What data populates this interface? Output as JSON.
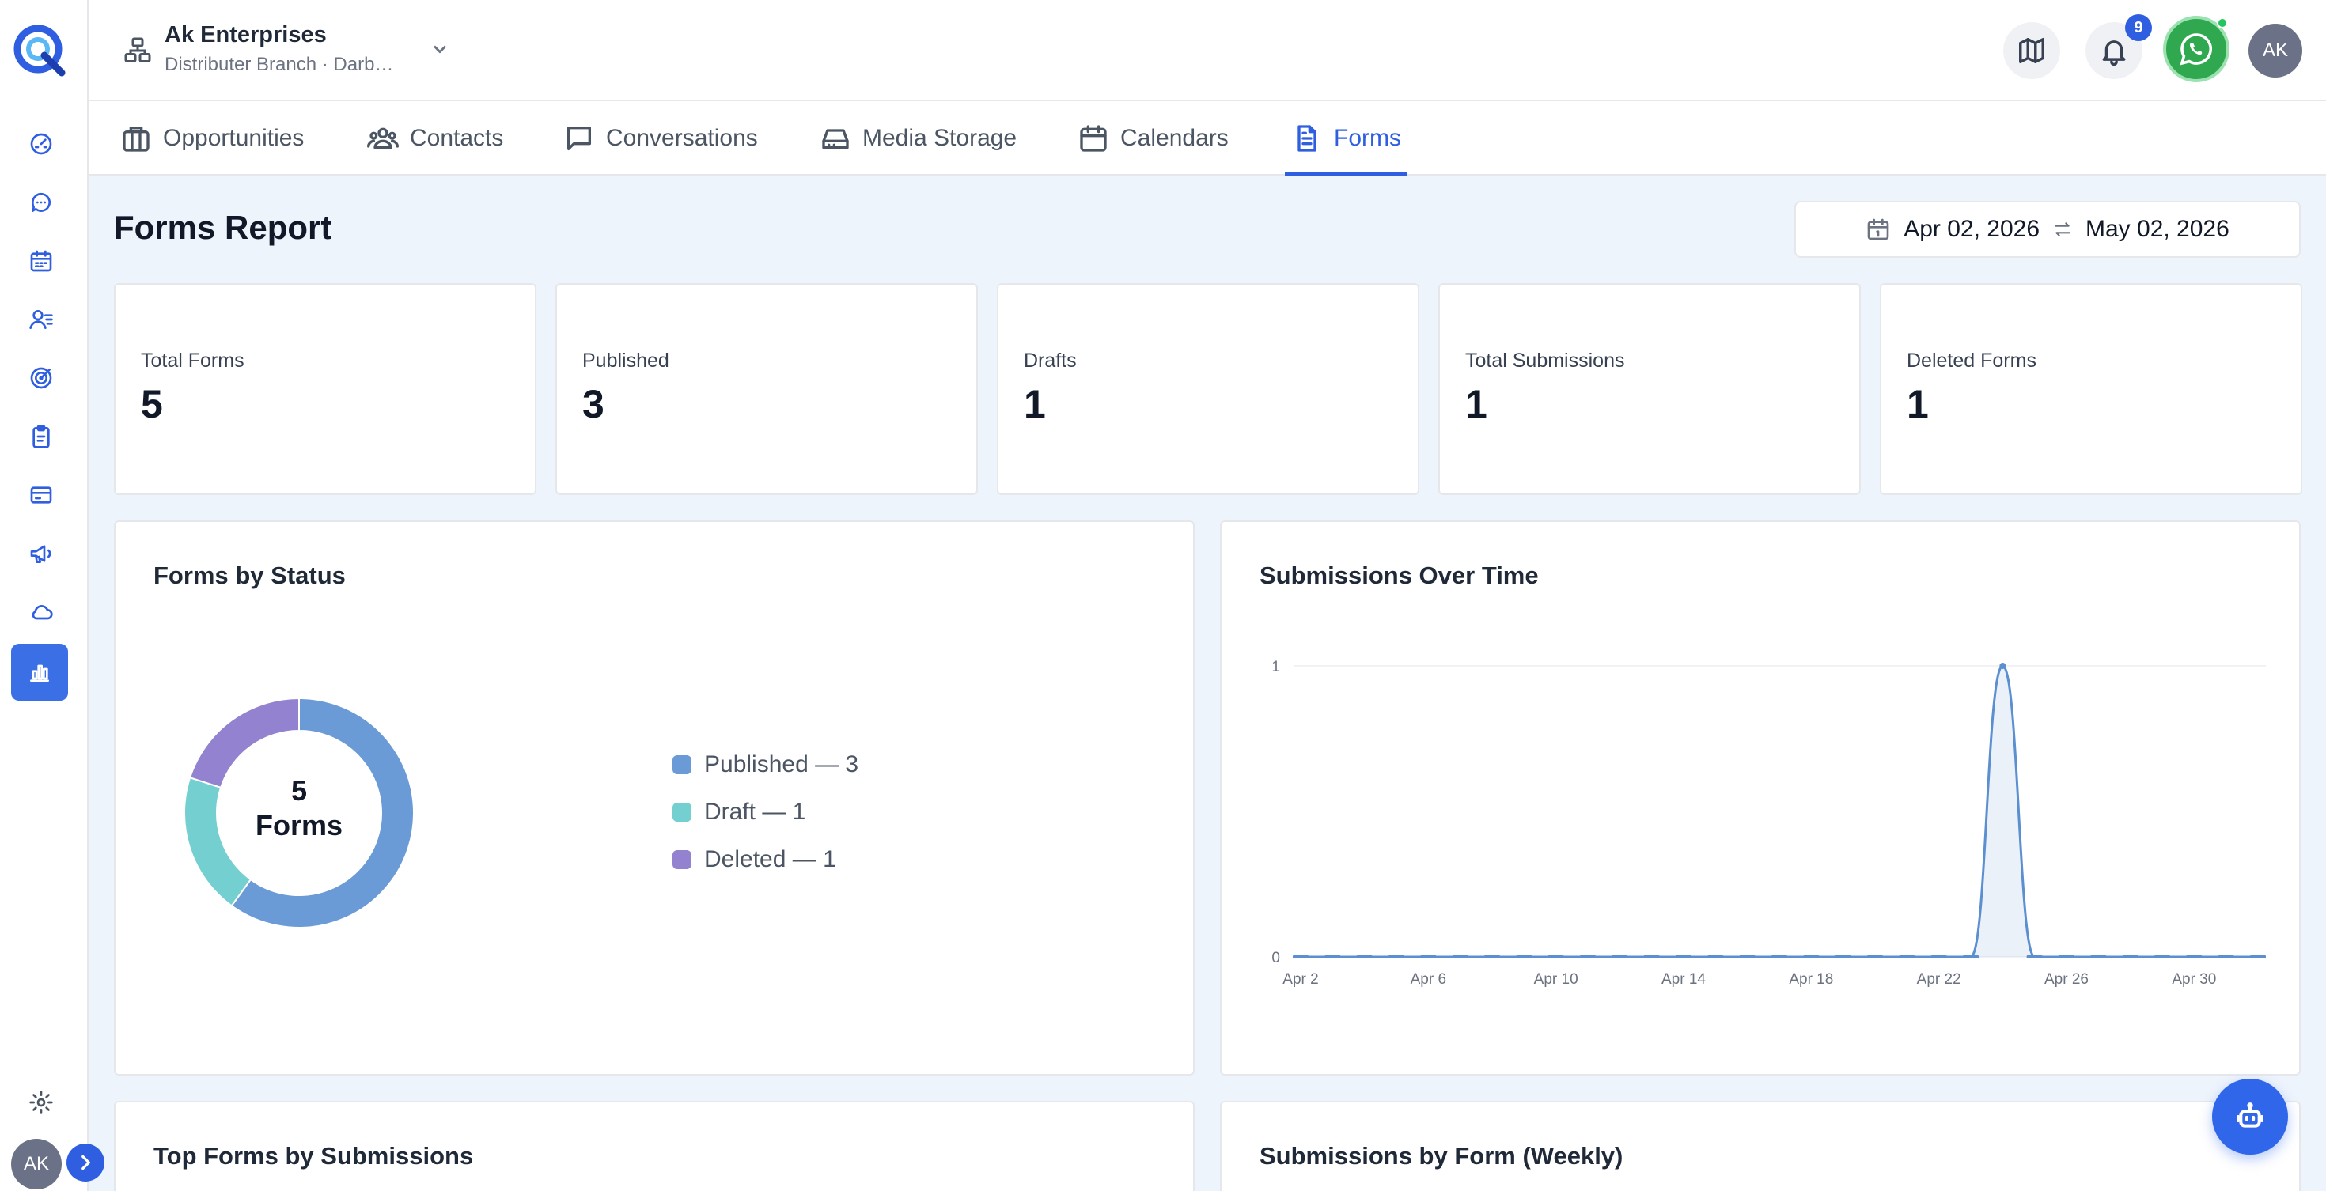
{
  "sidebar": {
    "logo": "app-logo",
    "items": [
      {
        "name": "dashboard-icon"
      },
      {
        "name": "chat-icon"
      },
      {
        "name": "calendar-icon"
      },
      {
        "name": "contacts-icon"
      },
      {
        "name": "target-icon"
      },
      {
        "name": "clipboard-icon"
      },
      {
        "name": "payments-icon"
      },
      {
        "name": "megaphone-icon"
      },
      {
        "name": "cloud-icon"
      },
      {
        "name": "reports-icon",
        "active": true
      }
    ],
    "settings_icon": "gear-icon",
    "avatar_initials": "AK",
    "expand_icon": "chevron-right-icon"
  },
  "header": {
    "business_name": "Ak Enterprises",
    "branch_subtitle": "Distributer Branch · Darb…",
    "notification_count": "9",
    "avatar_initials": "AK",
    "icons": [
      "map-icon",
      "bell-icon",
      "whatsapp-icon"
    ]
  },
  "tabs": [
    {
      "label": "Opportunities",
      "icon": "briefcase-icon"
    },
    {
      "label": "Contacts",
      "icon": "users-icon"
    },
    {
      "label": "Conversations",
      "icon": "message-icon"
    },
    {
      "label": "Media Storage",
      "icon": "drive-icon"
    },
    {
      "label": "Calendars",
      "icon": "calendar-icon"
    },
    {
      "label": "Forms",
      "icon": "document-icon",
      "active": true
    }
  ],
  "page": {
    "title": "Forms Report",
    "date_from": "Apr 02, 2026",
    "date_to": "May 02, 2026"
  },
  "stats": [
    {
      "label": "Total Forms",
      "value": "5"
    },
    {
      "label": "Published",
      "value": "3"
    },
    {
      "label": "Drafts",
      "value": "1"
    },
    {
      "label": "Total Submissions",
      "value": "1"
    },
    {
      "label": "Deleted Forms",
      "value": "1"
    }
  ],
  "panels": {
    "status_title": "Forms by Status",
    "time_title": "Submissions Over Time",
    "top_forms_title": "Top Forms by Submissions",
    "weekly_title": "Submissions by Form (Weekly)"
  },
  "colors": {
    "accent": "#2f5fe0",
    "published": "#6a9bd6",
    "draft": "#74cfd0",
    "deleted": "#9382cf",
    "line": "#5b8fd0"
  },
  "chart_data": [
    {
      "type": "pie",
      "title": "Forms by Status",
      "center_value": "5",
      "center_label": "Forms",
      "legend_position": "right",
      "slices": [
        {
          "label": "Published — 3",
          "value": 3,
          "color": "#6a9bd6"
        },
        {
          "label": "Draft — 1",
          "value": 1,
          "color": "#74cfd0"
        },
        {
          "label": "Deleted — 1",
          "value": 1,
          "color": "#9382cf"
        }
      ]
    },
    {
      "type": "line",
      "title": "Submissions Over Time",
      "xlabel": "",
      "ylabel": "",
      "x": [
        "Apr 2",
        "Apr 3",
        "Apr 4",
        "Apr 5",
        "Apr 6",
        "Apr 7",
        "Apr 8",
        "Apr 9",
        "Apr 10",
        "Apr 11",
        "Apr 12",
        "Apr 13",
        "Apr 14",
        "Apr 15",
        "Apr 16",
        "Apr 17",
        "Apr 18",
        "Apr 19",
        "Apr 20",
        "Apr 21",
        "Apr 22",
        "Apr 23",
        "Apr 24",
        "Apr 25",
        "Apr 26",
        "Apr 27",
        "Apr 28",
        "Apr 29",
        "Apr 30",
        "May 1",
        "May 2"
      ],
      "x_ticks": [
        "Apr 2",
        "Apr 6",
        "Apr 10",
        "Apr 14",
        "Apr 18",
        "Apr 22",
        "Apr 26",
        "Apr 30"
      ],
      "y_ticks": [
        "0",
        "1"
      ],
      "ylim": [
        0,
        1
      ],
      "grid": true,
      "series": [
        {
          "values": [
            0,
            0,
            0,
            0,
            0,
            0,
            0,
            0,
            0,
            0,
            0,
            0,
            0,
            0,
            0,
            0,
            0,
            0,
            0,
            0,
            0,
            0,
            1,
            0,
            0,
            0,
            0,
            0,
            0,
            0,
            0
          ]
        }
      ]
    }
  ]
}
